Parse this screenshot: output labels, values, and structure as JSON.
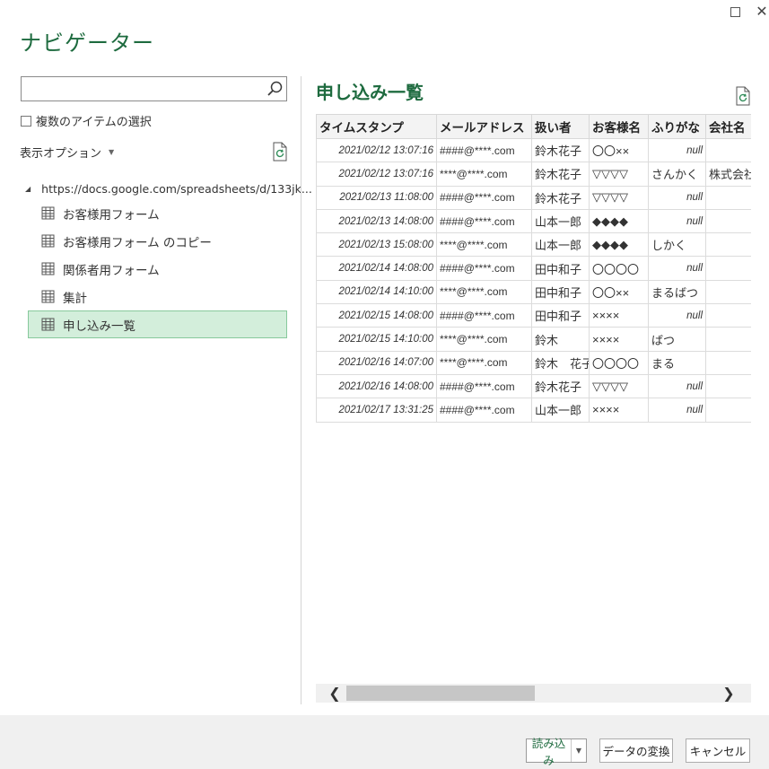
{
  "window": {
    "title": "ナビゲーター",
    "maximize_glyph": "□",
    "close_glyph": "✕"
  },
  "search": {
    "placeholder": "",
    "value": ""
  },
  "multi_select": {
    "label": "複数のアイテムの選択",
    "checked": false
  },
  "display_options": {
    "label": "表示オプション",
    "caret": "▼"
  },
  "tree": {
    "root": {
      "label": "https://docs.google.com/spreadsheets/d/133jk...",
      "expand_glyph": "◢"
    },
    "items": [
      {
        "label": "お客様用フォーム",
        "selected": false
      },
      {
        "label": "お客様用フォーム のコピー",
        "selected": false
      },
      {
        "label": "関係者用フォーム",
        "selected": false
      },
      {
        "label": "集計",
        "selected": false
      },
      {
        "label": "申し込み一覧",
        "selected": true
      }
    ]
  },
  "preview": {
    "title": "申し込み一覧",
    "columns": [
      "タイムスタンプ",
      "メールアドレス",
      "扱い者",
      "お客様名",
      "ふりがな",
      "会社名"
    ],
    "rows": [
      [
        "2021/02/12 13:07:16",
        "####@****.com",
        "鈴木花子",
        "〇〇××",
        "null",
        ""
      ],
      [
        "2021/02/12 13:07:16",
        "****@****.com",
        "鈴木花子",
        "▽▽▽▽",
        "さんかく",
        "株式会社"
      ],
      [
        "2021/02/13 11:08:00",
        "####@****.com",
        "鈴木花子",
        "▽▽▽▽",
        "null",
        ""
      ],
      [
        "2021/02/13 14:08:00",
        "####@****.com",
        "山本一郎",
        "◆◆◆◆",
        "null",
        ""
      ],
      [
        "2021/02/13 15:08:00",
        "****@****.com",
        "山本一郎",
        "◆◆◆◆",
        "しかく",
        ""
      ],
      [
        "2021/02/14 14:08:00",
        "####@****.com",
        "田中和子",
        "〇〇〇〇",
        "null",
        ""
      ],
      [
        "2021/02/14 14:10:00",
        "****@****.com",
        "田中和子",
        "〇〇××",
        "まるばつ",
        ""
      ],
      [
        "2021/02/15 14:08:00",
        "####@****.com",
        "田中和子",
        "××××",
        "null",
        ""
      ],
      [
        "2021/02/15 14:10:00",
        "****@****.com",
        "鈴木",
        "××××",
        "ばつ",
        ""
      ],
      [
        "2021/02/16 14:07:00",
        "****@****.com",
        "鈴木　花子",
        "〇〇〇〇",
        "まる",
        ""
      ],
      [
        "2021/02/16 14:08:00",
        "####@****.com",
        "鈴木花子",
        "▽▽▽▽",
        "null",
        ""
      ],
      [
        "2021/02/17 13:31:25",
        "####@****.com",
        "山本一郎",
        "××××",
        "null",
        ""
      ]
    ]
  },
  "scrollbar": {
    "left_glyph": "❮",
    "right_glyph": "❯"
  },
  "footer": {
    "load_label": "読み込み",
    "load_dropdown_glyph": "▼",
    "transform_label": "データの変換",
    "cancel_label": "キャンセル"
  },
  "colors": {
    "accent": "#1e6b3f",
    "selected_bg": "#d3eedb",
    "selected_border": "#87c99c",
    "footer_bg": "#f0f0f0"
  }
}
